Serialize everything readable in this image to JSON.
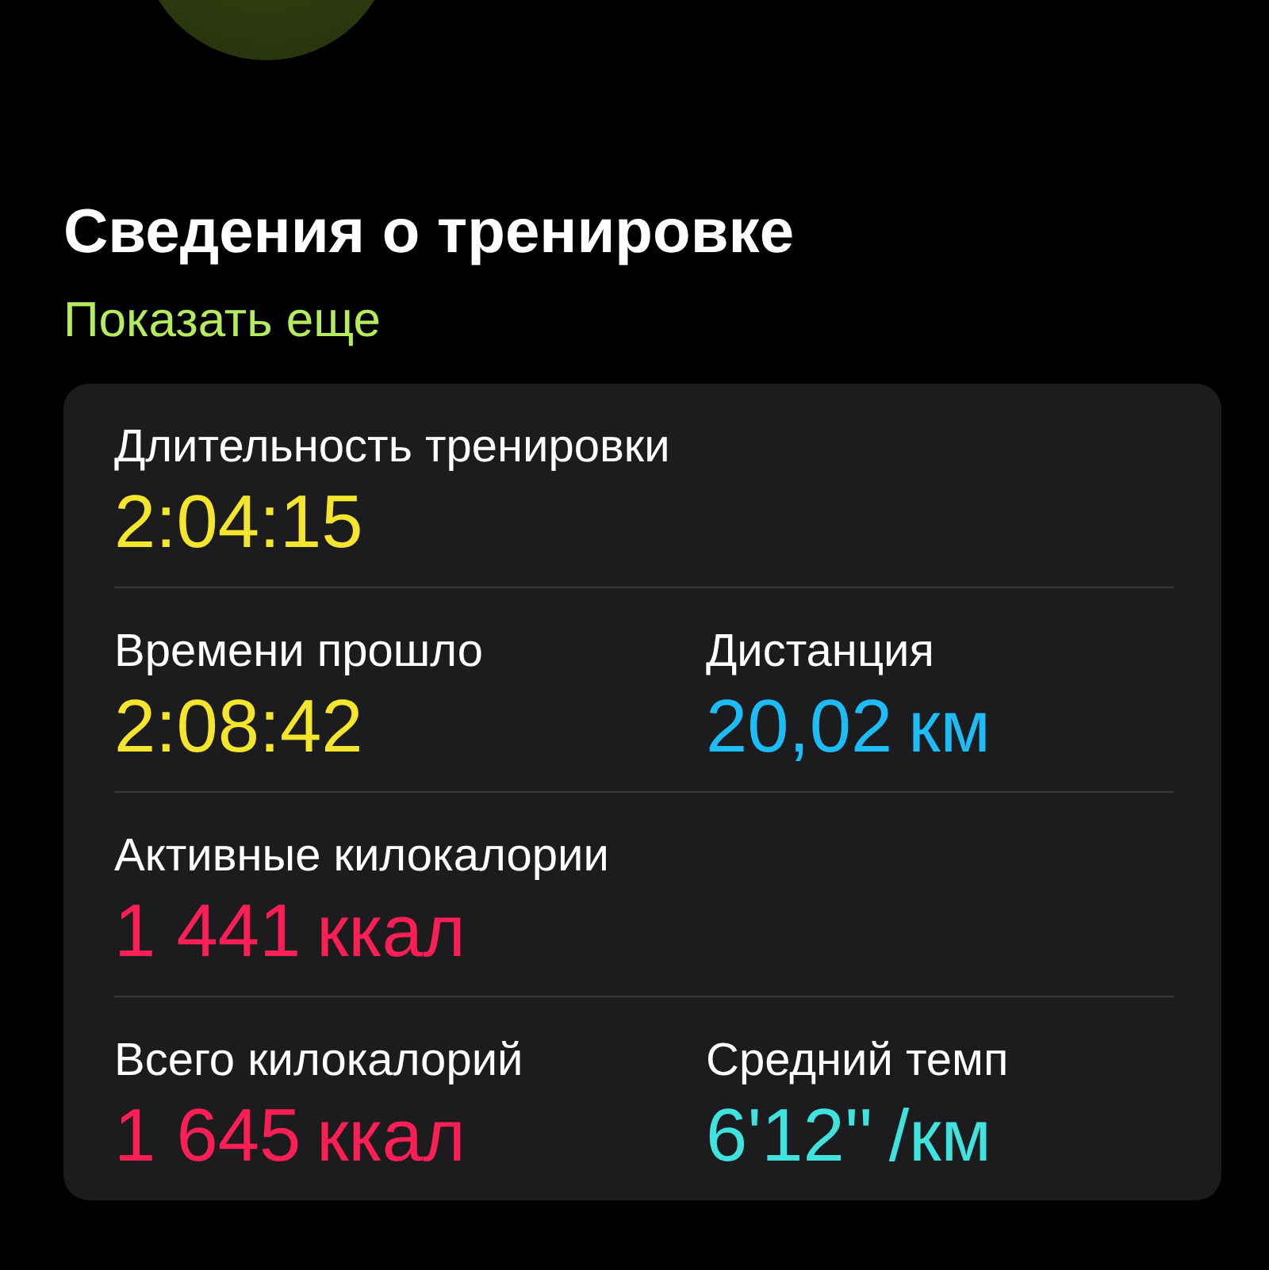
{
  "title": "Сведения о тренировке",
  "show_more_link": "Показать еще",
  "metrics": [
    {
      "items": [
        {
          "label": "Длительность тренировки",
          "value": "2:04:15",
          "color": "#f5e52c"
        }
      ]
    },
    {
      "items": [
        {
          "label": "Времени прошло",
          "value": "2:08:42",
          "color": "#f5e52c"
        },
        {
          "label": "Дистанция",
          "value": "20,02",
          "unit": "км",
          "color": "#1ebcf7"
        }
      ]
    },
    {
      "items": [
        {
          "label": "Активные килокалории",
          "value": "1 441",
          "unit": "ккал",
          "color": "#fb1f55"
        }
      ]
    },
    {
      "items": [
        {
          "label": "Всего килокалорий",
          "value": "1 645",
          "unit": "ккал",
          "color": "#fb1f55"
        },
        {
          "label": "Средний темп",
          "value": "6'12''",
          "unit": "/км",
          "color": "#3fe2dd"
        }
      ]
    }
  ]
}
